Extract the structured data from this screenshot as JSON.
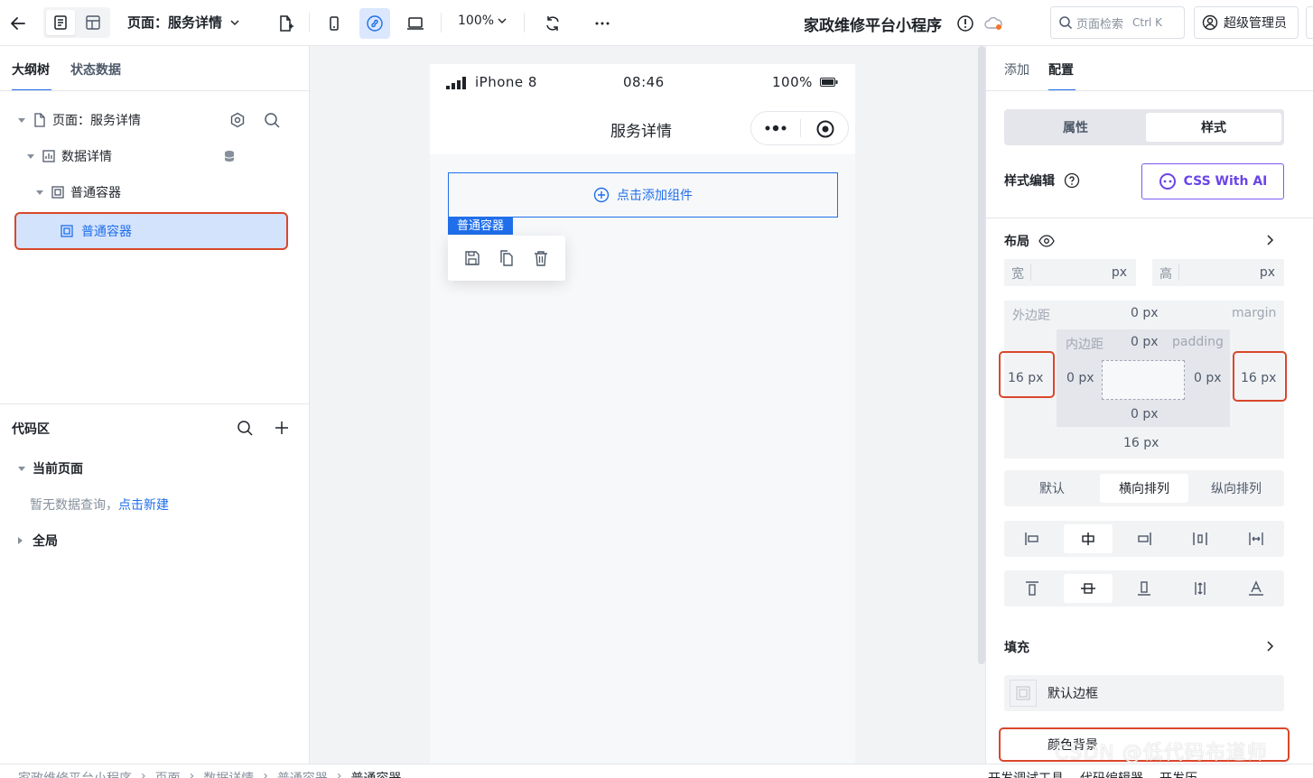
{
  "topbar": {
    "page_selector": "页面：服务详情",
    "zoom": "100%",
    "app_title": "家政维修平台小程序",
    "search_placeholder": "页面检索",
    "search_shortcut": "Ctrl K",
    "user": "超级管理员"
  },
  "left": {
    "tabs": [
      "大纲树",
      "状态数据"
    ],
    "tree": [
      {
        "label": "页面：服务详情"
      },
      {
        "label": "数据详情"
      },
      {
        "label": "普通容器"
      },
      {
        "label": "普通容器"
      }
    ],
    "code_area": {
      "title": "代码区",
      "current_page": "当前页面",
      "empty_text": "暂无数据查询，",
      "create_link": "点击新建",
      "global": "全局"
    }
  },
  "canvas": {
    "status": {
      "carrier": "iPhone 8",
      "time": "08:46",
      "battery": "100%"
    },
    "nav_title": "服务详情",
    "add_component": "点击添加组件",
    "component_tag": "普通容器"
  },
  "right": {
    "tabs": [
      "添加",
      "配置"
    ],
    "attr_tabs": [
      "属性",
      "样式"
    ],
    "style_edit": "样式编辑",
    "css_ai": "CSS With AI",
    "layout": "布局",
    "width_label": "宽",
    "height_label": "高",
    "unit": "px",
    "margin": {
      "label_cn": "外边距",
      "label_en": "margin",
      "top": "0 px",
      "left": "16 px",
      "right": "16 px",
      "bottom": "16 px"
    },
    "padding": {
      "label_cn": "内边距",
      "label_en": "padding",
      "top": "0 px",
      "left": "0 px",
      "right": "0 px",
      "bottom": "0 px"
    },
    "direction": [
      "默认",
      "横向排列",
      "纵向排列"
    ],
    "fill": "填充",
    "default_border": "默认边框",
    "color_bg": "颜色背景"
  },
  "watermark": "CSDN @低代码布道师",
  "bottom": {
    "breadcrumb": [
      "家政维修平台小程序",
      "页面",
      "数据详情",
      "普通容器",
      "普通容器"
    ],
    "tools": [
      "开发调试工具",
      "代码编辑器",
      "开发历"
    ]
  }
}
